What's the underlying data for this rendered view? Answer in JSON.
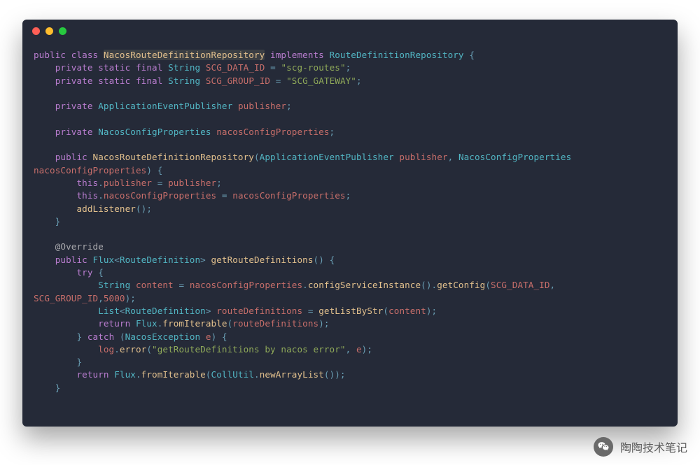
{
  "window": {
    "kind": "code-editor",
    "titlebar_buttons": [
      "close",
      "minimize",
      "zoom"
    ]
  },
  "watermark": {
    "text": "陶陶技术笔记",
    "icon_name": "wechat-icon"
  },
  "code": {
    "language": "java",
    "tokens": [
      [
        [
          "kw",
          "public"
        ],
        [
          "p",
          " "
        ],
        [
          "kw",
          "class"
        ],
        [
          "p",
          " "
        ],
        [
          "name hl",
          "NacosRouteDefinitionRepository"
        ],
        [
          "p",
          " "
        ],
        [
          "kw",
          "implements"
        ],
        [
          "p",
          " "
        ],
        [
          "type",
          "RouteDefinitionRepository"
        ],
        [
          "p",
          " "
        ],
        [
          "punc",
          "{"
        ]
      ],
      [
        [
          "p",
          "    "
        ],
        [
          "kw",
          "private"
        ],
        [
          "p",
          " "
        ],
        [
          "kw",
          "static"
        ],
        [
          "p",
          " "
        ],
        [
          "kw",
          "final"
        ],
        [
          "p",
          " "
        ],
        [
          "type",
          "String"
        ],
        [
          "p",
          " "
        ],
        [
          "var",
          "SCG_DATA_ID"
        ],
        [
          "p",
          " "
        ],
        [
          "punc",
          "="
        ],
        [
          "p",
          " "
        ],
        [
          "str",
          "\"scg-routes\""
        ],
        [
          "punc",
          ";"
        ]
      ],
      [
        [
          "p",
          "    "
        ],
        [
          "kw",
          "private"
        ],
        [
          "p",
          " "
        ],
        [
          "kw",
          "static"
        ],
        [
          "p",
          " "
        ],
        [
          "kw",
          "final"
        ],
        [
          "p",
          " "
        ],
        [
          "type",
          "String"
        ],
        [
          "p",
          " "
        ],
        [
          "var",
          "SCG_GROUP_ID"
        ],
        [
          "p",
          " "
        ],
        [
          "punc",
          "="
        ],
        [
          "p",
          " "
        ],
        [
          "str",
          "\"SCG_GATEWAY\""
        ],
        [
          "punc",
          ";"
        ]
      ],
      [
        [
          "p",
          ""
        ]
      ],
      [
        [
          "p",
          "    "
        ],
        [
          "kw",
          "private"
        ],
        [
          "p",
          " "
        ],
        [
          "type",
          "ApplicationEventPublisher"
        ],
        [
          "p",
          " "
        ],
        [
          "var",
          "publisher"
        ],
        [
          "punc",
          ";"
        ]
      ],
      [
        [
          "p",
          ""
        ]
      ],
      [
        [
          "p",
          "    "
        ],
        [
          "kw",
          "private"
        ],
        [
          "p",
          " "
        ],
        [
          "type",
          "NacosConfigProperties"
        ],
        [
          "p",
          " "
        ],
        [
          "var",
          "nacosConfigProperties"
        ],
        [
          "punc",
          ";"
        ]
      ],
      [
        [
          "p",
          ""
        ]
      ],
      [
        [
          "p",
          "    "
        ],
        [
          "kw",
          "public"
        ],
        [
          "p",
          " "
        ],
        [
          "name",
          "NacosRouteDefinitionRepository"
        ],
        [
          "punc",
          "("
        ],
        [
          "type",
          "ApplicationEventPublisher"
        ],
        [
          "p",
          " "
        ],
        [
          "var",
          "publisher"
        ],
        [
          "punc",
          ","
        ],
        [
          "p",
          " "
        ],
        [
          "type",
          "NacosConfigProperties"
        ],
        [
          "p",
          " "
        ]
      ],
      [
        [
          "var",
          "nacosConfigProperties"
        ],
        [
          "punc",
          ")"
        ],
        [
          "p",
          " "
        ],
        [
          "punc",
          "{"
        ]
      ],
      [
        [
          "p",
          "        "
        ],
        [
          "kw",
          "this"
        ],
        [
          "punc",
          "."
        ],
        [
          "var",
          "publisher"
        ],
        [
          "p",
          " "
        ],
        [
          "punc",
          "="
        ],
        [
          "p",
          " "
        ],
        [
          "var",
          "publisher"
        ],
        [
          "punc",
          ";"
        ]
      ],
      [
        [
          "p",
          "        "
        ],
        [
          "kw",
          "this"
        ],
        [
          "punc",
          "."
        ],
        [
          "var",
          "nacosConfigProperties"
        ],
        [
          "p",
          " "
        ],
        [
          "punc",
          "="
        ],
        [
          "p",
          " "
        ],
        [
          "var",
          "nacosConfigProperties"
        ],
        [
          "punc",
          ";"
        ]
      ],
      [
        [
          "p",
          "        "
        ],
        [
          "name",
          "addListener"
        ],
        [
          "punc",
          "();"
        ]
      ],
      [
        [
          "p",
          "    "
        ],
        [
          "punc",
          "}"
        ]
      ],
      [
        [
          "p",
          ""
        ]
      ],
      [
        [
          "p",
          "    "
        ],
        [
          "ann",
          "@Override"
        ]
      ],
      [
        [
          "p",
          "    "
        ],
        [
          "kw",
          "public"
        ],
        [
          "p",
          " "
        ],
        [
          "type",
          "Flux"
        ],
        [
          "punc",
          "<"
        ],
        [
          "type",
          "RouteDefinition"
        ],
        [
          "punc",
          ">"
        ],
        [
          "p",
          " "
        ],
        [
          "name",
          "getRouteDefinitions"
        ],
        [
          "punc",
          "()"
        ],
        [
          "p",
          " "
        ],
        [
          "punc",
          "{"
        ]
      ],
      [
        [
          "p",
          "        "
        ],
        [
          "kw",
          "try"
        ],
        [
          "p",
          " "
        ],
        [
          "punc",
          "{"
        ]
      ],
      [
        [
          "p",
          "            "
        ],
        [
          "type",
          "String"
        ],
        [
          "p",
          " "
        ],
        [
          "var",
          "content"
        ],
        [
          "p",
          " "
        ],
        [
          "punc",
          "="
        ],
        [
          "p",
          " "
        ],
        [
          "var",
          "nacosConfigProperties"
        ],
        [
          "punc",
          "."
        ],
        [
          "name",
          "configServiceInstance"
        ],
        [
          "punc",
          "()."
        ],
        [
          "name",
          "getConfig"
        ],
        [
          "punc",
          "("
        ],
        [
          "var",
          "SCG_DATA_ID"
        ],
        [
          "punc",
          ","
        ],
        [
          "p",
          " "
        ]
      ],
      [
        [
          "var",
          "SCG_GROUP_ID"
        ],
        [
          "punc",
          ","
        ],
        [
          "num",
          "5000"
        ],
        [
          "punc",
          ");"
        ]
      ],
      [
        [
          "p",
          "            "
        ],
        [
          "type",
          "List"
        ],
        [
          "punc",
          "<"
        ],
        [
          "type",
          "RouteDefinition"
        ],
        [
          "punc",
          ">"
        ],
        [
          "p",
          " "
        ],
        [
          "var",
          "routeDefinitions"
        ],
        [
          "p",
          " "
        ],
        [
          "punc",
          "="
        ],
        [
          "p",
          " "
        ],
        [
          "name",
          "getListByStr"
        ],
        [
          "punc",
          "("
        ],
        [
          "var",
          "content"
        ],
        [
          "punc",
          ");"
        ]
      ],
      [
        [
          "p",
          "            "
        ],
        [
          "kw",
          "return"
        ],
        [
          "p",
          " "
        ],
        [
          "type",
          "Flux"
        ],
        [
          "punc",
          "."
        ],
        [
          "name",
          "fromIterable"
        ],
        [
          "punc",
          "("
        ],
        [
          "var",
          "routeDefinitions"
        ],
        [
          "punc",
          ");"
        ]
      ],
      [
        [
          "p",
          "        "
        ],
        [
          "punc",
          "}"
        ],
        [
          "p",
          " "
        ],
        [
          "kw",
          "catch"
        ],
        [
          "p",
          " "
        ],
        [
          "punc",
          "("
        ],
        [
          "type",
          "NacosException"
        ],
        [
          "p",
          " "
        ],
        [
          "var",
          "e"
        ],
        [
          "punc",
          ")"
        ],
        [
          "p",
          " "
        ],
        [
          "punc",
          "{"
        ]
      ],
      [
        [
          "p",
          "            "
        ],
        [
          "var",
          "log"
        ],
        [
          "punc",
          "."
        ],
        [
          "name",
          "error"
        ],
        [
          "punc",
          "("
        ],
        [
          "str",
          "\"getRouteDefinitions by nacos error\""
        ],
        [
          "punc",
          ","
        ],
        [
          "p",
          " "
        ],
        [
          "var",
          "e"
        ],
        [
          "punc",
          ");"
        ]
      ],
      [
        [
          "p",
          "        "
        ],
        [
          "punc",
          "}"
        ]
      ],
      [
        [
          "p",
          "        "
        ],
        [
          "kw",
          "return"
        ],
        [
          "p",
          " "
        ],
        [
          "type",
          "Flux"
        ],
        [
          "punc",
          "."
        ],
        [
          "name",
          "fromIterable"
        ],
        [
          "punc",
          "("
        ],
        [
          "type",
          "CollUtil"
        ],
        [
          "punc",
          "."
        ],
        [
          "name",
          "newArrayList"
        ],
        [
          "punc",
          "());"
        ]
      ],
      [
        [
          "p",
          "    "
        ],
        [
          "punc",
          "}"
        ]
      ]
    ]
  }
}
